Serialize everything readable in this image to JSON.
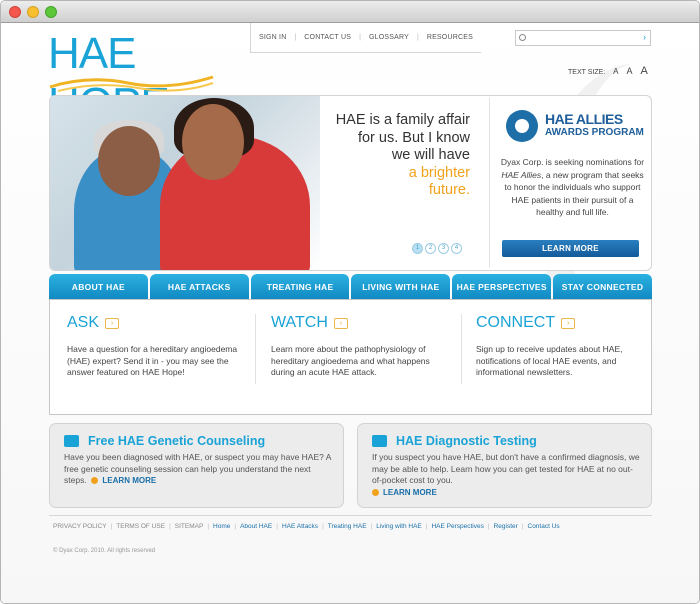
{
  "logo": {
    "part1": "HAE",
    "part2": "HOPE"
  },
  "topnav": {
    "items": [
      "SIGN IN",
      "CONTACT US",
      "GLOSSARY",
      "RESOURCES"
    ]
  },
  "search": {
    "placeholder": ""
  },
  "textsize": {
    "label": "TEXT SIZE:",
    "small": "A",
    "medium": "A",
    "large": "A"
  },
  "hero": {
    "line1": "HAE is a family affair",
    "line2": "for us. But I know",
    "line3": "we will have",
    "highlight1": "a brighter",
    "highlight2": "future.",
    "dots": [
      "1",
      "2",
      "3",
      "4"
    ]
  },
  "allies": {
    "title": "HAE ALLIES",
    "subtitle": "AWARDS PROGRAM",
    "desc_a": "Dyax Corp. is seeking nominations for ",
    "desc_b": "HAE Allies",
    "desc_c": ", a new program that seeks to honor the individuals who support HAE patients in their pursuit of a healthy and full life.",
    "button": "LEARN MORE"
  },
  "mainnav": [
    "ABOUT HAE",
    "HAE ATTACKS",
    "TREATING HAE",
    "LIVING WITH HAE",
    "HAE PERSPECTIVES",
    "STAY CONNECTED"
  ],
  "columns": [
    {
      "title": "ASK",
      "text": "Have a question for a hereditary angioedema (HAE) expert? Send it in - you may see the answer featured on HAE Hope!"
    },
    {
      "title": "WATCH",
      "text": "Learn more about the pathophysiology of hereditary angioedema and what happens during an acute HAE attack."
    },
    {
      "title": "CONNECT",
      "text": "Sign up to receive updates about HAE, notifications of local HAE events, and informational newsletters."
    }
  ],
  "boxes": [
    {
      "title": "Free HAE Genetic Counseling",
      "text": "Have you been diagnosed with HAE, or suspect you may have HAE? A free genetic counseling session can help you understand the next steps.",
      "link": "LEARN MORE"
    },
    {
      "title": "HAE Diagnostic Testing",
      "text": "If you suspect you have HAE, but don't have a confirmed diagnosis, we may be able to help. Learn how you can get tested for HAE at no out-of-pocket cost to you.",
      "link": "LEARN MORE"
    }
  ],
  "footer": {
    "gray": [
      "PRIVACY POLICY",
      "TERMS OF USE",
      "SITEMAP"
    ],
    "links": [
      "Home",
      "About HAE",
      "HAE Attacks",
      "Treating HAE",
      "Living with HAE",
      "HAE Perspectives",
      "Register",
      "Contact Us"
    ],
    "copyright": "© Dyax Corp. 2010. All rights reserved"
  }
}
